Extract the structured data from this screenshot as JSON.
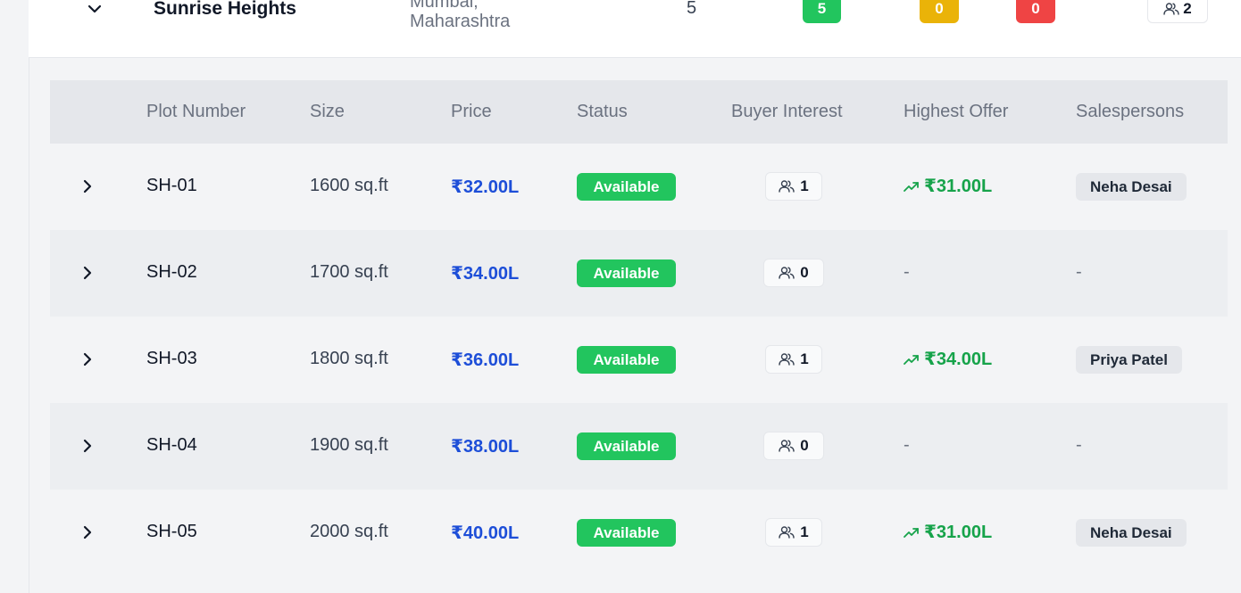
{
  "project": {
    "name": "Sunrise Heights",
    "location_line1": "Mumbai,",
    "location_line2": "Maharashtra",
    "total_plots": "5",
    "available_count": "5",
    "reserved_count": "0",
    "sold_count": "0",
    "salespersons_count": "2"
  },
  "colors": {
    "available": "#22c55e",
    "reserved": "#eab308",
    "sold": "#ef4444",
    "price": "#1d4ed8",
    "offer": "#16a34a"
  },
  "table": {
    "headers": {
      "plot_number": "Plot Number",
      "size": "Size",
      "price": "Price",
      "status": "Status",
      "buyer_interest": "Buyer Interest",
      "highest_offer": "Highest Offer",
      "salespersons": "Salespersons"
    },
    "rows": [
      {
        "plot": "SH-01",
        "size": "1600 sq.ft",
        "price": "₹32.00L",
        "status": "Available",
        "interest": "1",
        "offer": "₹31.00L",
        "salesperson": "Neha Desai"
      },
      {
        "plot": "SH-02",
        "size": "1700 sq.ft",
        "price": "₹34.00L",
        "status": "Available",
        "interest": "0",
        "offer": "-",
        "salesperson": "-"
      },
      {
        "plot": "SH-03",
        "size": "1800 sq.ft",
        "price": "₹36.00L",
        "status": "Available",
        "interest": "1",
        "offer": "₹34.00L",
        "salesperson": "Priya Patel"
      },
      {
        "plot": "SH-04",
        "size": "1900 sq.ft",
        "price": "₹38.00L",
        "status": "Available",
        "interest": "0",
        "offer": "-",
        "salesperson": "-"
      },
      {
        "plot": "SH-05",
        "size": "2000 sq.ft",
        "price": "₹40.00L",
        "status": "Available",
        "interest": "1",
        "offer": "₹31.00L",
        "salesperson": "Neha Desai"
      }
    ]
  }
}
